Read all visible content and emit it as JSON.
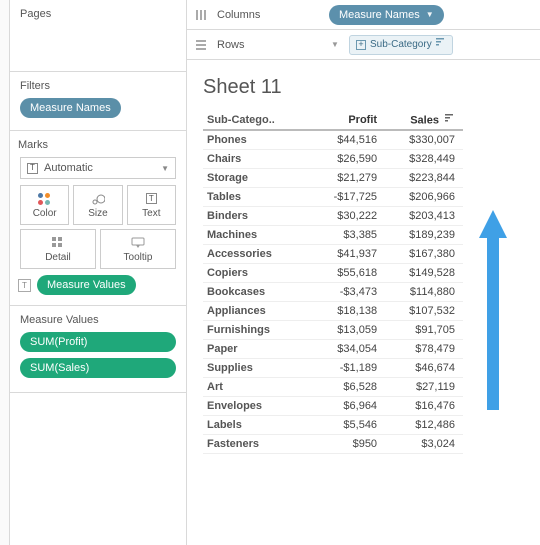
{
  "sidebar": {
    "pages_title": "Pages",
    "filters_title": "Filters",
    "filter_pill": "Measure Names",
    "marks_title": "Marks",
    "marks_select": "Automatic",
    "mark_buttons": {
      "color": "Color",
      "size": "Size",
      "text": "Text",
      "detail": "Detail",
      "tooltip": "Tooltip"
    },
    "measure_values_pill": "Measure Values",
    "mv_title": "Measure Values",
    "mv_pills": [
      "SUM(Profit)",
      "SUM(Sales)"
    ]
  },
  "shelves": {
    "columns_label": "Columns",
    "columns_pill": "Measure Names",
    "rows_label": "Rows",
    "rows_field": "Sub-Category"
  },
  "sheet": {
    "title": "Sheet 11",
    "headers": [
      "Sub-Catego..",
      "Profit",
      "Sales"
    ],
    "sort_indicator_on": "Sales",
    "rows": [
      {
        "sub": "Phones",
        "profit": "$44,516",
        "sales": "$330,007"
      },
      {
        "sub": "Chairs",
        "profit": "$26,590",
        "sales": "$328,449"
      },
      {
        "sub": "Storage",
        "profit": "$21,279",
        "sales": "$223,844"
      },
      {
        "sub": "Tables",
        "profit": "-$17,725",
        "sales": "$206,966"
      },
      {
        "sub": "Binders",
        "profit": "$30,222",
        "sales": "$203,413"
      },
      {
        "sub": "Machines",
        "profit": "$3,385",
        "sales": "$189,239"
      },
      {
        "sub": "Accessories",
        "profit": "$41,937",
        "sales": "$167,380"
      },
      {
        "sub": "Copiers",
        "profit": "$55,618",
        "sales": "$149,528"
      },
      {
        "sub": "Bookcases",
        "profit": "-$3,473",
        "sales": "$114,880"
      },
      {
        "sub": "Appliances",
        "profit": "$18,138",
        "sales": "$107,532"
      },
      {
        "sub": "Furnishings",
        "profit": "$13,059",
        "sales": "$91,705"
      },
      {
        "sub": "Paper",
        "profit": "$34,054",
        "sales": "$78,479"
      },
      {
        "sub": "Supplies",
        "profit": "-$1,189",
        "sales": "$46,674"
      },
      {
        "sub": "Art",
        "profit": "$6,528",
        "sales": "$27,119"
      },
      {
        "sub": "Envelopes",
        "profit": "$6,964",
        "sales": "$16,476"
      },
      {
        "sub": "Labels",
        "profit": "$5,546",
        "sales": "$12,486"
      },
      {
        "sub": "Fasteners",
        "profit": "$950",
        "sales": "$3,024"
      }
    ]
  },
  "colors": {
    "blue_pill": "#5b8fa8",
    "green_pill": "#1fa87a",
    "arrow": "#3fa0e6"
  },
  "chart_data": {
    "type": "table",
    "title": "Sheet 11",
    "columns": [
      "Sub-Category",
      "Profit",
      "Sales"
    ],
    "sort": {
      "column": "Sales",
      "order": "desc"
    },
    "rows": [
      [
        "Phones",
        44516,
        330007
      ],
      [
        "Chairs",
        26590,
        328449
      ],
      [
        "Storage",
        21279,
        223844
      ],
      [
        "Tables",
        -17725,
        206966
      ],
      [
        "Binders",
        30222,
        203413
      ],
      [
        "Machines",
        3385,
        189239
      ],
      [
        "Accessories",
        41937,
        167380
      ],
      [
        "Copiers",
        55618,
        149528
      ],
      [
        "Bookcases",
        -3473,
        114880
      ],
      [
        "Appliances",
        18138,
        107532
      ],
      [
        "Furnishings",
        13059,
        91705
      ],
      [
        "Paper",
        34054,
        78479
      ],
      [
        "Supplies",
        -1189,
        46674
      ],
      [
        "Art",
        6528,
        27119
      ],
      [
        "Envelopes",
        6964,
        16476
      ],
      [
        "Labels",
        5546,
        12486
      ],
      [
        "Fasteners",
        950,
        3024
      ]
    ]
  }
}
